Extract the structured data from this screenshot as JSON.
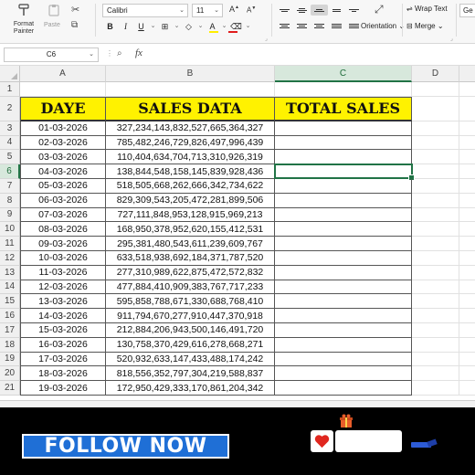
{
  "ribbon": {
    "format_painter_label": "Format Painter",
    "paste_label": "Paste",
    "font_name": "Calibri",
    "font_size": "11",
    "wrap_text_label": "Wrap Text",
    "orientation_label": "Orientation",
    "merge_label": "Merge",
    "number_format_partial": "Ge",
    "colors": {
      "fill": "#ffee00",
      "font_color": "#e01c1c"
    }
  },
  "formula_bar": {
    "name_box": "C6",
    "fx_label": "fx",
    "value": ""
  },
  "grid": {
    "columns": [
      "A",
      "B",
      "C",
      "D"
    ],
    "selected_column": "C",
    "selected_row": 6,
    "headers": {
      "date": "DAYE",
      "sales": "SALES DATA",
      "total": "TOTAL SALES"
    },
    "rows": [
      {
        "num": "1",
        "date": "",
        "sales": ""
      },
      {
        "num": "2",
        "date": "",
        "sales": ""
      },
      {
        "num": "3",
        "date": "01-03-2026",
        "sales": "327,234,143,832,527,665,364,327"
      },
      {
        "num": "4",
        "date": "02-03-2026",
        "sales": "785,482,246,729,826,497,996,439"
      },
      {
        "num": "5",
        "date": "03-03-2026",
        "sales": "110,404,634,704,713,310,926,319"
      },
      {
        "num": "6",
        "date": "04-03-2026",
        "sales": "138,844,548,158,145,839,928,436"
      },
      {
        "num": "7",
        "date": "05-03-2026",
        "sales": "518,505,668,262,666,342,734,622"
      },
      {
        "num": "8",
        "date": "06-03-2026",
        "sales": "829,309,543,205,472,281,899,506"
      },
      {
        "num": "9",
        "date": "07-03-2026",
        "sales": "727,111,848,953,128,915,969,213"
      },
      {
        "num": "10",
        "date": "08-03-2026",
        "sales": "168,950,378,952,620,155,412,531"
      },
      {
        "num": "11",
        "date": "09-03-2026",
        "sales": "295,381,480,543,611,239,609,767"
      },
      {
        "num": "12",
        "date": "10-03-2026",
        "sales": "633,518,938,692,184,371,787,520"
      },
      {
        "num": "13",
        "date": "11-03-2026",
        "sales": "277,310,989,622,875,472,572,832"
      },
      {
        "num": "14",
        "date": "12-03-2026",
        "sales": "477,884,410,909,383,767,717,233"
      },
      {
        "num": "15",
        "date": "13-03-2026",
        "sales": "595,858,788,671,330,688,768,410"
      },
      {
        "num": "16",
        "date": "14-03-2026",
        "sales": "911,794,670,277,910,447,370,918"
      },
      {
        "num": "17",
        "date": "15-03-2026",
        "sales": "212,884,206,943,500,146,491,720"
      },
      {
        "num": "18",
        "date": "16-03-2026",
        "sales": "130,758,370,429,616,278,668,271"
      },
      {
        "num": "19",
        "date": "17-03-2026",
        "sales": "520,932,633,147,433,488,174,242"
      },
      {
        "num": "20",
        "date": "18-03-2026",
        "sales": "818,556,352,797,304,219,588,837"
      },
      {
        "num": "21",
        "date": "19-03-2026",
        "sales": "172,950,429,333,170,861,204,342"
      }
    ]
  },
  "banner": {
    "follow_label": "FOLLOW NOW",
    "colors": {
      "button": "#1f6fd6",
      "heart": "#e0271f",
      "background": "#000000"
    }
  }
}
